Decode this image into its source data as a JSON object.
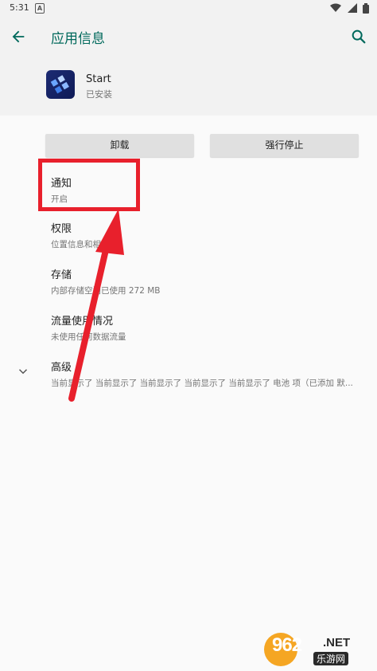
{
  "status_bar": {
    "time": "5:31",
    "a_badge": "A"
  },
  "app_bar": {
    "title": "应用信息"
  },
  "app": {
    "name": "Start",
    "status": "已安装"
  },
  "buttons": {
    "uninstall": "卸载",
    "force_stop": "强行停止"
  },
  "rows": [
    {
      "title": "通知",
      "subtitle": "开启"
    },
    {
      "title": "权限",
      "subtitle": "位置信息和相机"
    },
    {
      "title": "存储",
      "subtitle": "内部存储空间已使用 272 MB"
    },
    {
      "title": "流量使用情况",
      "subtitle": "未使用任何数据流量"
    },
    {
      "title": "高级",
      "subtitle": "当前显示了 当前显示了 当前显示了 当前显示了 当前显示了 电池 项（已添加 默..."
    }
  ],
  "watermark": {
    "brand_number": "962",
    "brand_suffix": ".NET",
    "brand_cn": "乐游网"
  },
  "colors": {
    "accent": "#00695c",
    "highlight": "#e8202c",
    "background": "#fafafa",
    "header": "#f2f2f2"
  },
  "icons": [
    "back-arrow-icon",
    "search-icon",
    "chevron-down-icon",
    "wifi-icon",
    "signal-icon",
    "battery-icon"
  ]
}
